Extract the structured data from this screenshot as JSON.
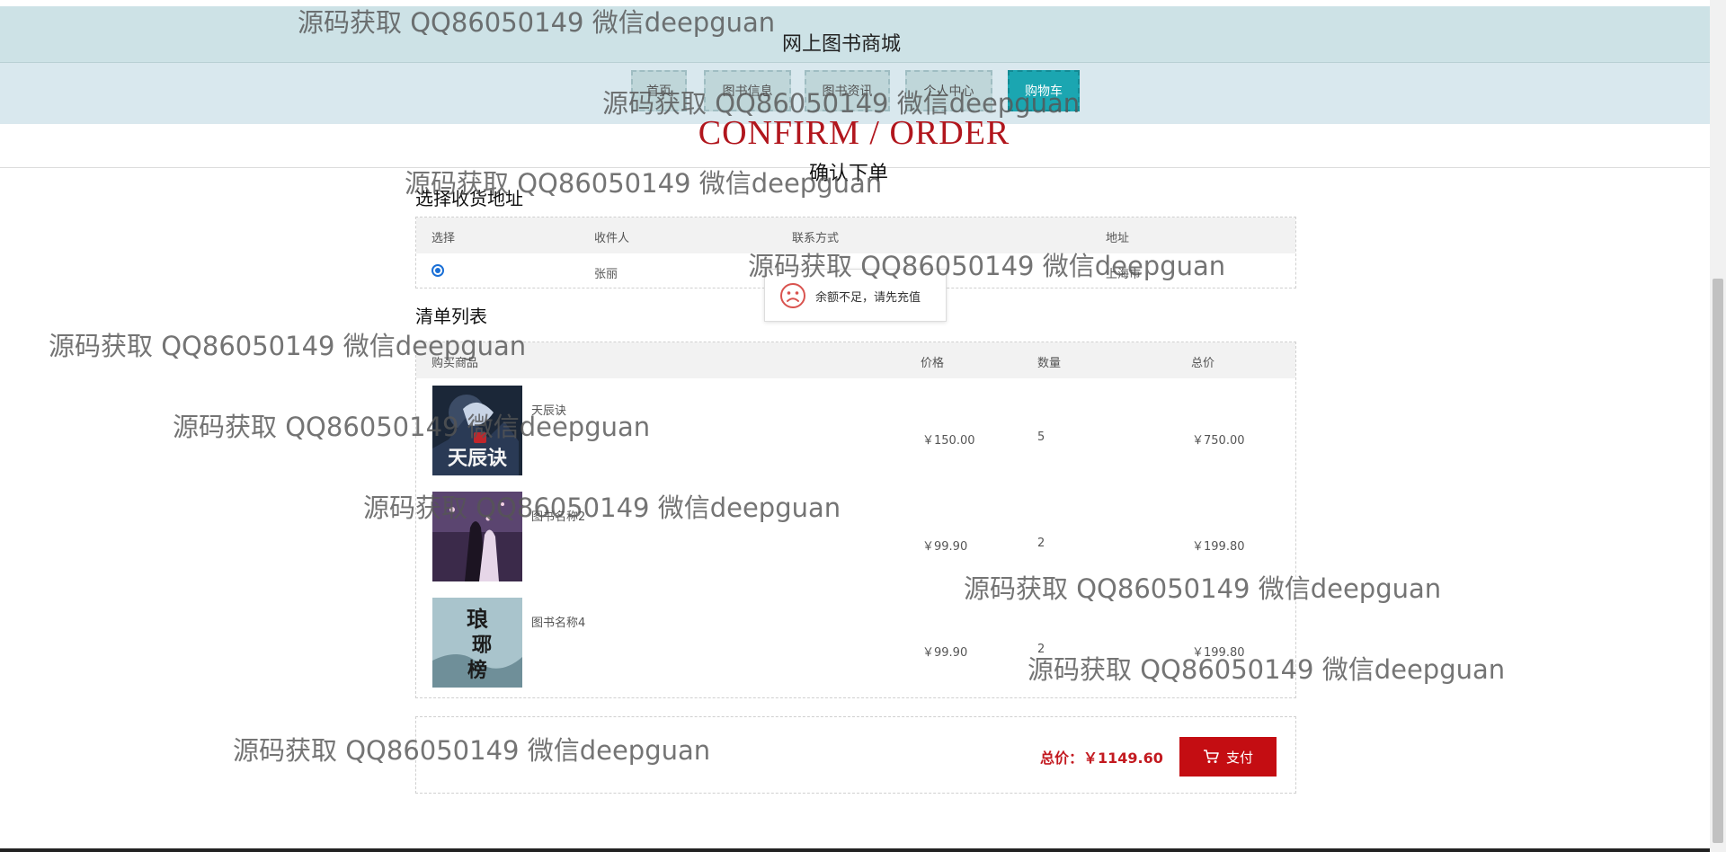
{
  "header": {
    "site_title": "网上图书商城",
    "nav": [
      {
        "label": "首页"
      },
      {
        "label": "图书信息"
      },
      {
        "label": "图书资讯"
      },
      {
        "label": "个人中心"
      },
      {
        "label": "购物车",
        "active": true
      }
    ]
  },
  "hero": {
    "title_en": "CONFIRM / ORDER",
    "title_cn": "确认下单"
  },
  "address": {
    "section_label": "选择收货地址",
    "columns": [
      "选择",
      "收件人",
      "联系方式",
      "地址"
    ],
    "rows": [
      {
        "selected": true,
        "recipient": "张丽",
        "phone": "",
        "address": "上海市"
      }
    ]
  },
  "toast": {
    "message": "余额不足，请先充值",
    "icon": "sad-face-icon"
  },
  "order_list": {
    "section_label": "清单列表",
    "columns": [
      "购买商品",
      "价格",
      "数量",
      "总价"
    ],
    "items": [
      {
        "name": "天辰诀",
        "price": "￥150.00",
        "qty": "5",
        "total": "￥750.00"
      },
      {
        "name": "图书名称2",
        "price": "￥99.90",
        "qty": "2",
        "total": "￥199.80"
      },
      {
        "name": "图书名称4",
        "price": "￥99.90",
        "qty": "2",
        "total": "￥199.80"
      }
    ]
  },
  "summary": {
    "total_text": "总价：￥1149.60",
    "pay_label": "支付"
  },
  "watermark": {
    "text": "源码获取 QQ86050149 微信deepguan"
  },
  "colors": {
    "title_bar": "#cde2e6",
    "nav_bar": "#d9e8ee",
    "nav_active": "#1ba6b1",
    "accent_red": "#c40d12"
  }
}
